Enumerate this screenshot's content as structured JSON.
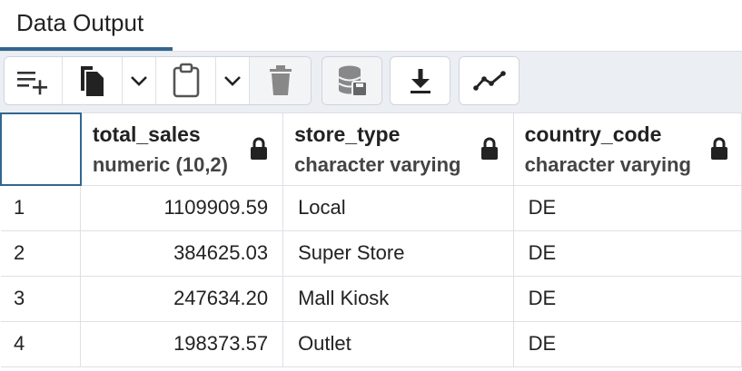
{
  "tab": {
    "label": "Data Output"
  },
  "toolbar": {
    "buttons": [
      {
        "name": "add-row-button",
        "icon": "add-row-icon"
      },
      {
        "name": "copy-button",
        "icon": "copy-icon"
      },
      {
        "name": "copy-options-button",
        "icon": "chevron-down-icon"
      },
      {
        "name": "paste-button",
        "icon": "clipboard-icon"
      },
      {
        "name": "paste-options-button",
        "icon": "chevron-down-icon"
      },
      {
        "name": "delete-button",
        "icon": "trash-icon"
      },
      {
        "name": "save-data-button",
        "icon": "database-save-icon"
      },
      {
        "name": "download-button",
        "icon": "download-icon"
      },
      {
        "name": "graph-visualiser-button",
        "icon": "line-graph-icon"
      }
    ]
  },
  "table": {
    "columns": [
      {
        "name": "total_sales",
        "type": "numeric (10,2)"
      },
      {
        "name": "store_type",
        "type": "character varying"
      },
      {
        "name": "country_code",
        "type": "character varying"
      }
    ],
    "rows": [
      {
        "num": "1",
        "total_sales": "1109909.59",
        "store_type": "Local",
        "country_code": "DE"
      },
      {
        "num": "2",
        "total_sales": "384625.03",
        "store_type": "Super Store",
        "country_code": "DE"
      },
      {
        "num": "3",
        "total_sales": "247634.20",
        "store_type": "Mall Kiosk",
        "country_code": "DE"
      },
      {
        "num": "4",
        "total_sales": "198373.57",
        "store_type": "Outlet",
        "country_code": "DE"
      }
    ]
  },
  "colors": {
    "accent": "#326690",
    "toolbar_bg": "#ebeef3",
    "border": "#dde0e6",
    "icon": "#222222"
  }
}
